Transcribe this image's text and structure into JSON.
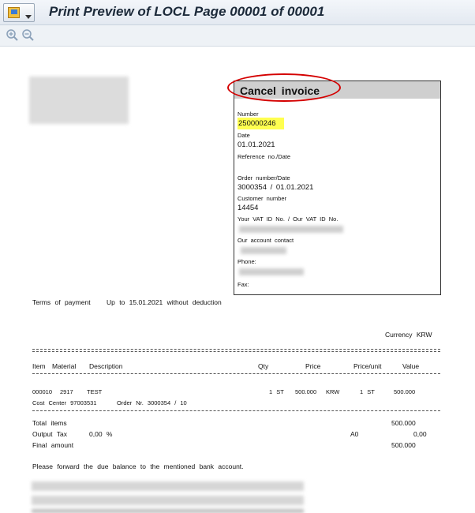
{
  "window": {
    "title": "Print Preview of LOCL Page 00001 of 00001"
  },
  "toolbar": {
    "zoom_in_icon": "zoom-in-icon",
    "zoom_out_icon": "zoom-out-icon"
  },
  "invoice": {
    "title": "Cancel invoice",
    "number_label": "Number",
    "number": "250000246",
    "date_label": "Date",
    "date": "01.01.2021",
    "reference_label": "Reference  no./Date",
    "order_label": "Order  number/Date",
    "order_value": "3000354  /  01.01.2021",
    "customer_label": "Customer  number",
    "customer_value": "14454",
    "vat_label": "Your VAT ID No.  /  Our VAT ID No.",
    "contact_label": "Our  account  contact",
    "phone_label": "Phone:",
    "fax_label": "Fax:"
  },
  "terms": {
    "label": "Terms of payment",
    "text": "Up to 15.01.2021  without  deduction"
  },
  "currency": "Currency KRW",
  "table": {
    "headers": {
      "item": "Item",
      "material": "Material",
      "description": "Description",
      "qty": "Qty",
      "price": "Price",
      "price_unit": "Price/unit",
      "value": "Value"
    },
    "row": {
      "item": "000010",
      "material": "2917",
      "description": "TEST",
      "qty": "1 ST",
      "price": "500.000",
      "currency": "KRW",
      "per": "1 ST",
      "value": "500.000",
      "cost_center": "Cost Center 97003531",
      "order_nr": "Order Nr.  3000354  /  10"
    }
  },
  "totals": {
    "total_items_label": "Total items",
    "total_items_value": "500.000",
    "tax_label": "Output Tax",
    "tax_rate": "0,00 %",
    "tax_code": "A0",
    "tax_value": "0,00",
    "final_label": "Final  amount",
    "final_value": "500.000"
  },
  "footer_text": "Please  forward  the  due  balance  to  the  mentioned  bank  account."
}
